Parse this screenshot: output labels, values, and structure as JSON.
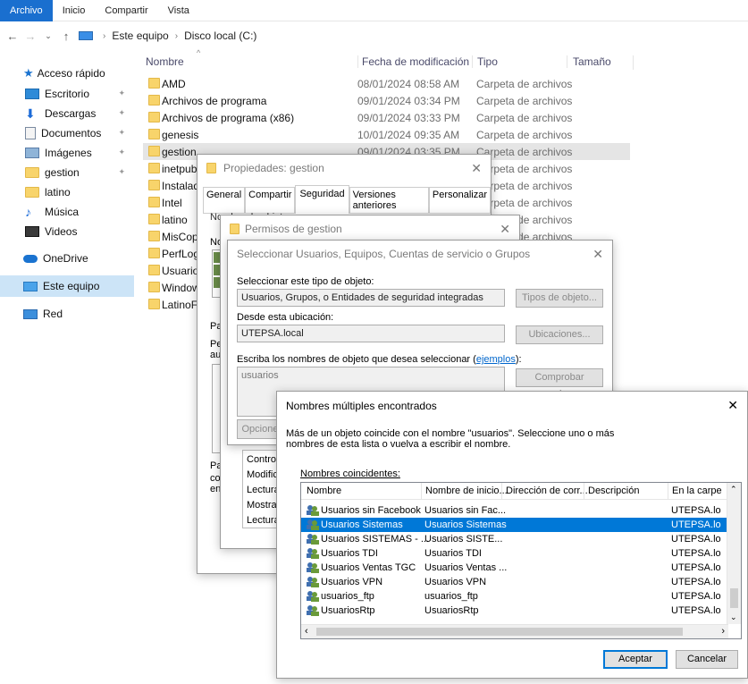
{
  "ribbon": {
    "tabs": [
      "Archivo",
      "Inicio",
      "Compartir",
      "Vista"
    ]
  },
  "address": {
    "crumbs": [
      "Este equipo",
      "Disco local (C:)"
    ]
  },
  "sidebar": {
    "quick_access": "Acceso rápido",
    "items": [
      {
        "label": "Escritorio",
        "icon": "desktop-icon",
        "pinned": true
      },
      {
        "label": "Descargas",
        "icon": "download-icon",
        "pinned": true
      },
      {
        "label": "Documentos",
        "icon": "document-icon",
        "pinned": true
      },
      {
        "label": "Imágenes",
        "icon": "image-icon",
        "pinned": true
      },
      {
        "label": "gestion",
        "icon": "folder-icon",
        "pinned": true
      },
      {
        "label": "latino",
        "icon": "folder-icon",
        "pinned": false
      },
      {
        "label": "Música",
        "icon": "music-icon",
        "pinned": false
      },
      {
        "label": "Videos",
        "icon": "video-icon",
        "pinned": false
      }
    ],
    "onedrive": "OneDrive",
    "this_pc": "Este equipo",
    "network": "Red"
  },
  "files": {
    "columns": [
      "Nombre",
      "Fecha de modificación",
      "Tipo",
      "Tamaño"
    ],
    "rows": [
      {
        "name": "AMD",
        "date": "08/01/2024 08:58 AM",
        "type": "Carpeta de archivos"
      },
      {
        "name": "Archivos de programa",
        "date": "09/01/2024 03:34 PM",
        "type": "Carpeta de archivos"
      },
      {
        "name": "Archivos de programa (x86)",
        "date": "09/01/2024 03:33 PM",
        "type": "Carpeta de archivos"
      },
      {
        "name": "genesis",
        "date": "10/01/2024 09:35 AM",
        "type": "Carpeta de archivos"
      },
      {
        "name": "gestion",
        "date": "09/01/2024 03:35 PM",
        "type": "Carpeta de archivos"
      },
      {
        "name": "inetpub",
        "date": "",
        "type": "Carpeta de archivos"
      },
      {
        "name": "Instalad",
        "date": "",
        "type": "Carpeta de archivos"
      },
      {
        "name": "Intel",
        "date": "",
        "type": "Carpeta de archivos"
      },
      {
        "name": "latino",
        "date": "",
        "type": "Carpeta de archivos"
      },
      {
        "name": "MisCop",
        "date": "",
        "type": "Carpeta de archivos"
      },
      {
        "name": "PerfLog",
        "date": "",
        "type": ""
      },
      {
        "name": "Usuario",
        "date": "",
        "type": ""
      },
      {
        "name": "Window",
        "date": "",
        "type": ""
      },
      {
        "name": "LatinoF",
        "date": "",
        "type": ""
      }
    ]
  },
  "props": {
    "title": "Propiedades: gestion",
    "tabs": [
      "General",
      "Compartir",
      "Seguridad",
      "Versiones anteriores",
      "Personalizar"
    ],
    "object_label": "Nombre de objeto:",
    "object_value": "C:\\gestion",
    "frag_no": "No",
    "frag_pa": "Pa",
    "frag_pe": "Pe",
    "frag_au": "aut",
    "frag_pa2": "Pa",
    "frag_co": "co",
    "frag_en": "en"
  },
  "perms": {
    "title": "Permisos de gestion",
    "perm_list": [
      "Control",
      "Modifica",
      "Lectura",
      "Mostrar",
      "Lectura"
    ]
  },
  "select": {
    "title": "Seleccionar Usuarios, Equipos, Cuentas de servicio o Grupos",
    "type_label": "Seleccionar este tipo de objeto:",
    "type_value": "Usuarios, Grupos, o Entidades de seguridad integradas",
    "type_btn": "Tipos de objeto...",
    "loc_label": "Desde esta ubicación:",
    "loc_value": "UTEPSA.local",
    "loc_btn": "Ubicaciones...",
    "names_label": "Escriba los nombres de objeto que desea seleccionar (",
    "names_link": "ejemplos",
    "names_label_end": "):",
    "names_value": "usuarios",
    "check_btn": "Comprobar nombres",
    "options_btn": "Opcione"
  },
  "multi": {
    "title": "Nombres múltiples encontrados",
    "message_1": "Más de un objeto coincide con el nombre \"usuarios\". Seleccione uno o más",
    "message_2": "nombres de esta lista o vuelva a escribir el nombre.",
    "list_label": "Nombres coincidentes:",
    "columns": [
      "Nombre",
      "Nombre de inicio...",
      "Dirección de corr...",
      "Descripción",
      "En la carpe"
    ],
    "rows": [
      {
        "name": "Usuarios sin Facebook",
        "login": "Usuarios sin Fac...",
        "folder": "UTEPSA.lo"
      },
      {
        "name": "Usuarios Sistemas",
        "login": "Usuarios Sistemas",
        "folder": "UTEPSA.lo",
        "selected": true
      },
      {
        "name": "Usuarios SISTEMAS - ...",
        "login": "Usuarios SISTE...",
        "folder": "UTEPSA.lo"
      },
      {
        "name": "Usuarios TDI",
        "login": "Usuarios TDI",
        "folder": "UTEPSA.lo"
      },
      {
        "name": "Usuarios Ventas TGC",
        "login": "Usuarios Ventas ...",
        "folder": "UTEPSA.lo"
      },
      {
        "name": "Usuarios VPN",
        "login": "Usuarios VPN",
        "folder": "UTEPSA.lo"
      },
      {
        "name": "usuarios_ftp",
        "login": "usuarios_ftp",
        "folder": "UTEPSA.lo"
      },
      {
        "name": "UsuariosRtp",
        "login": "UsuariosRtp",
        "folder": "UTEPSA.lo"
      }
    ],
    "ok": "Aceptar",
    "cancel": "Cancelar"
  }
}
